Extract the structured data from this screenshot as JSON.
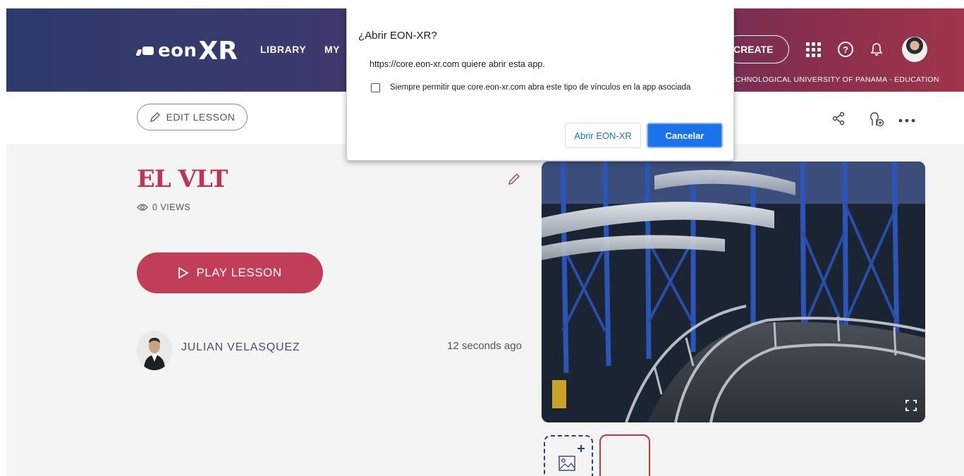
{
  "header": {
    "logo_text": "eon",
    "logo_xr": "XR",
    "nav": [
      "LIBRARY",
      "MY"
    ],
    "create_label": "CREATE",
    "org": "TECHNOLOGICAL UNIVERSITY OF PANAMA - EDUCATION",
    "icons": [
      "apps-grid-icon",
      "help-icon",
      "bell-icon",
      "user-avatar"
    ]
  },
  "toolbar": {
    "edit_label": "EDIT LESSON",
    "icons": [
      "share-icon",
      "add-user-icon",
      "more-icon"
    ]
  },
  "lesson": {
    "title": "EL VLT",
    "views": "0 VIEWS",
    "play_label": "PLAY LESSON",
    "author": "JULIAN VELASQUEZ",
    "timestamp": "12 seconds ago"
  },
  "dialog": {
    "title": "¿Abrir EON-XR?",
    "message": "https://core.eon-xr.com quiere abrir esta app.",
    "checkbox_label": "Siempre permitir que core.eon-xr.com abra este tipo de vínculos en la app asociada",
    "checkbox_checked": false,
    "open_label": "Abrir EON-XR",
    "cancel_label": "Cancelar"
  },
  "colors": {
    "accent": "#c0354d",
    "header_start": "#2d3a6b",
    "header_end": "#a0354b",
    "dialog_primary": "#1a73e8"
  }
}
